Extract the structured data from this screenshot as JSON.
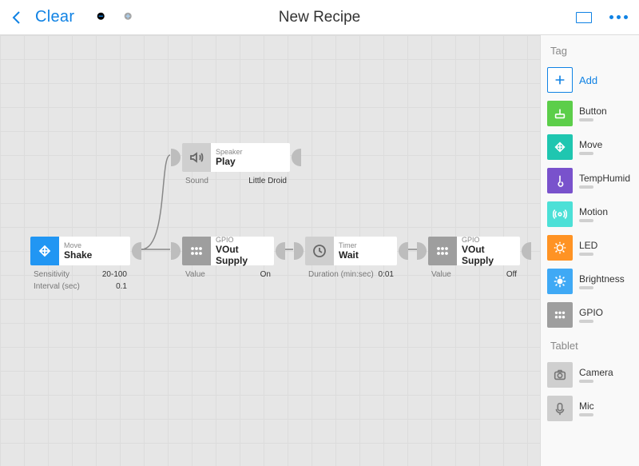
{
  "toolbar": {
    "back": "Back",
    "clear": "Clear",
    "title": "New Recipe"
  },
  "nodes": {
    "speaker": {
      "category": "Speaker",
      "title": "Play",
      "param1_key": "Sound",
      "param1_val": "Little Droid"
    },
    "shake": {
      "category": "Move",
      "title": "Shake",
      "param1_key": "Sensitivity",
      "param1_val": "20-100",
      "param2_key": "Interval (sec)",
      "param2_val": "0.1"
    },
    "gpio1": {
      "category": "GPIO",
      "title": "VOut Supply",
      "param1_key": "Value",
      "param1_val": "On"
    },
    "timer": {
      "category": "Timer",
      "title": "Wait",
      "param1_key": "Duration (min:sec)",
      "param1_val": "0:01"
    },
    "gpio2": {
      "category": "GPIO",
      "title": "VOut Supply",
      "param1_key": "Value",
      "param1_val": "Off"
    }
  },
  "sidebar": {
    "section_tag": "Tag",
    "section_tablet": "Tablet",
    "add": "Add",
    "button": "Button",
    "move": "Move",
    "temphumid": "TempHumid",
    "motion": "Motion",
    "led": "LED",
    "brightness": "Brightness",
    "gpio": "GPIO",
    "camera": "Camera",
    "mic": "Mic"
  }
}
